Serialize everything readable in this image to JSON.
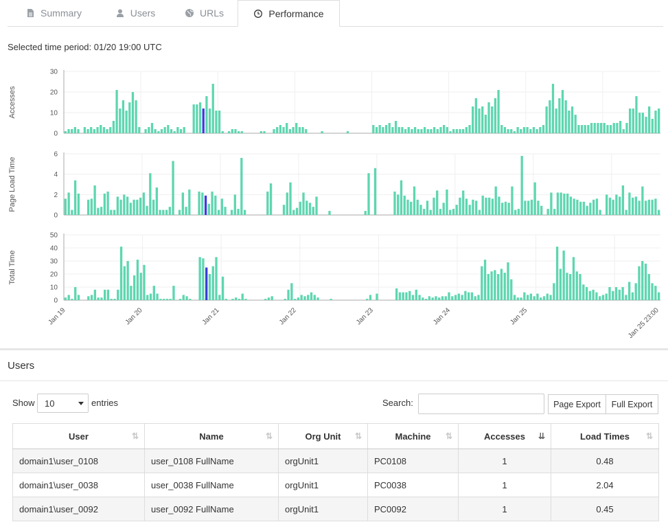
{
  "tabs": [
    {
      "label": "Summary",
      "icon": "file-icon",
      "active": false
    },
    {
      "label": "Users",
      "icon": "user-icon",
      "active": false
    },
    {
      "label": "URLs",
      "icon": "globe-icon",
      "active": false
    },
    {
      "label": "Performance",
      "icon": "clock-icon",
      "active": true
    }
  ],
  "selected_period": "Selected time period: 01/20 19:00 UTC",
  "colors": {
    "bar": "#5ed6b0",
    "highlight": "#3a3ae0",
    "grid": "#efefef",
    "axis": "#555555"
  },
  "chart_data": [
    {
      "type": "bar",
      "ylabel": "Accesses",
      "ylim": [
        0,
        30
      ],
      "yticks": [
        0,
        10,
        20,
        30
      ],
      "x_start": "Jan 19 00:00",
      "x_interval": "1 hour",
      "highlight_index": 43,
      "values": [
        1,
        2,
        2,
        3,
        2,
        0,
        3,
        2,
        3,
        2,
        3,
        4,
        3,
        2,
        3,
        6,
        21,
        12,
        16,
        11,
        15,
        20,
        16,
        3,
        0,
        2,
        3,
        5,
        2,
        1,
        2,
        3,
        4,
        2,
        1,
        3,
        2,
        3,
        0,
        0,
        14,
        14,
        15,
        12,
        18,
        12,
        24,
        11,
        11,
        1,
        0,
        1,
        2,
        2,
        1,
        1,
        0,
        0,
        0,
        0,
        0,
        1,
        1,
        0,
        0,
        2,
        3,
        4,
        3,
        5,
        2,
        3,
        5,
        3,
        3,
        2,
        0,
        0,
        0,
        0,
        1,
        0,
        0,
        0,
        0,
        0,
        0,
        0,
        1,
        0,
        0,
        0,
        0,
        0,
        0,
        0,
        4,
        3,
        4,
        3,
        4,
        5,
        3,
        6,
        3,
        3,
        2,
        3,
        2,
        3,
        2,
        2,
        3,
        2,
        2,
        3,
        2,
        3,
        4,
        3,
        1,
        2,
        2,
        2,
        2,
        3,
        4,
        13,
        17,
        12,
        13,
        9,
        15,
        13,
        17,
        21,
        4,
        3,
        2,
        2,
        1,
        3,
        2,
        3,
        3,
        2,
        3,
        2,
        3,
        4,
        13,
        16,
        24,
        12,
        17,
        21,
        16,
        11,
        13,
        9,
        4,
        4,
        4,
        4,
        5,
        5,
        5,
        5,
        5,
        4,
        4,
        5,
        5,
        6,
        2,
        5,
        12,
        12,
        18,
        10,
        10,
        8,
        13,
        7,
        11,
        12
      ]
    },
    {
      "type": "bar",
      "ylabel": "Page Load Time",
      "ylim": [
        0,
        6
      ],
      "yticks": [
        0,
        2,
        4,
        6
      ],
      "x_start": "Jan 19 00:00",
      "x_interval": "1 hour",
      "highlight_index": 43,
      "values": [
        1.6,
        2.2,
        0.5,
        3.4,
        2.1,
        0,
        0,
        1.5,
        1.6,
        2.9,
        0.7,
        0.8,
        2.1,
        2.3,
        0.5,
        0.5,
        1.8,
        1.5,
        2,
        1.8,
        1.2,
        1.5,
        1.5,
        1.7,
        2.2,
        0.9,
        4.1,
        1.5,
        2.7,
        0.5,
        0.5,
        0.5,
        0.8,
        5.3,
        0,
        0.5,
        2.2,
        0.8,
        2.5,
        0,
        0,
        2.3,
        2.2,
        1.9,
        1.1,
        2.3,
        1.9,
        0.5,
        1.6,
        0.8,
        0,
        0.5,
        2,
        0.6,
        5.6,
        0.5,
        0,
        0,
        0,
        0,
        0,
        0,
        2.3,
        3.1,
        0,
        0,
        0,
        1,
        2.2,
        3.2,
        0.5,
        0.7,
        1.3,
        2.2,
        1.4,
        1.2,
        0.8,
        1.8,
        0,
        0,
        0,
        0.4,
        0,
        0,
        0,
        0,
        0,
        0,
        0,
        0,
        0,
        0,
        0.4,
        4.1,
        0,
        4.6,
        0,
        0,
        0,
        0,
        0,
        2.3,
        2,
        3.4,
        1.9,
        1.5,
        1.3,
        2.8,
        1.5,
        1,
        0.6,
        1.4,
        0.5,
        1.7,
        2.4,
        0.6,
        1.2,
        2.5,
        0.5,
        0.6,
        1,
        1.7,
        2.4,
        1.6,
        1,
        1.5,
        1.4,
        0.5,
        1.9,
        1.7,
        1.7,
        1.6,
        2.8,
        1.8,
        1.2,
        1.3,
        1.2,
        2.8,
        0.5,
        0.6,
        5.8,
        1.4,
        1.4,
        1.5,
        3.2,
        1.4,
        0.9,
        0,
        0.6,
        2.2,
        0.6,
        2.2,
        2.2,
        2.1,
        2.1,
        1.8,
        1.6,
        1.5,
        1.3,
        1.3,
        0.9,
        1.2,
        1.5,
        1.6,
        0.5,
        0,
        2.0,
        1.7,
        1.5,
        2.0,
        1.8,
        2.9,
        0.5,
        2.2,
        1.7,
        1.8,
        1.4,
        2.8,
        1.4,
        1.5,
        1.5,
        1.6,
        0.5
      ]
    },
    {
      "type": "bar",
      "ylabel": "Total Time",
      "ylim": [
        0,
        50
      ],
      "yticks": [
        0,
        10,
        20,
        30,
        40,
        50
      ],
      "x_start": "Jan 19 00:00",
      "x_interval": "1 hour",
      "highlight_index": 43,
      "values": [
        2,
        4,
        1,
        10,
        4,
        0,
        0,
        3,
        4,
        8,
        2,
        2,
        8,
        8,
        1,
        1,
        8,
        41,
        26,
        30,
        11,
        19,
        31,
        21,
        27,
        4,
        5,
        11,
        5,
        1,
        1,
        1,
        1,
        11,
        0,
        1,
        4,
        3,
        1,
        0,
        0,
        33,
        32,
        25,
        20,
        26,
        33,
        4,
        18,
        1,
        0,
        1,
        2,
        1,
        5,
        1,
        0,
        0,
        0,
        0,
        0,
        1,
        2,
        3,
        0,
        0,
        0,
        1,
        8,
        13,
        1,
        2,
        4,
        3,
        4,
        6,
        4,
        2,
        0,
        0,
        0,
        1,
        0,
        0,
        0,
        0,
        0,
        0,
        0,
        0,
        0,
        0,
        1,
        4,
        0,
        5,
        0,
        0,
        0,
        0,
        0,
        9,
        6,
        6,
        6,
        7,
        4,
        8,
        4,
        2,
        1,
        3,
        2,
        3,
        2,
        3,
        3,
        6,
        3,
        4,
        5,
        4,
        7,
        6,
        6,
        3,
        4,
        26,
        31,
        20,
        22,
        23,
        20,
        24,
        21,
        29,
        16,
        4,
        2,
        2,
        6,
        4,
        5,
        3,
        5,
        2,
        3,
        5,
        4,
        13,
        41,
        24,
        38,
        21,
        20,
        33,
        22,
        20,
        12,
        10,
        7,
        8,
        6,
        3,
        4,
        5,
        10,
        7,
        10,
        8,
        10,
        4,
        14,
        6,
        13,
        26,
        30,
        28,
        20,
        13,
        11,
        6
      ]
    }
  ],
  "x_axis_labels": [
    "Jan 19",
    "Jan 20",
    "Jan 21",
    "Jan 22",
    "Jan 23",
    "Jan 24",
    "Jan 25",
    "Jan 25 23:00"
  ],
  "users_section": {
    "title": "Users",
    "show_label": "Show",
    "page_size": "10",
    "entries_label": "entries",
    "search_label": "Search:",
    "search_value": "",
    "page_export": "Page Export",
    "full_export": "Full Export",
    "columns": [
      "User",
      "Name",
      "Org Unit",
      "Machine",
      "Accesses",
      "Load Times"
    ],
    "rows": [
      [
        "domain1\\user_0108",
        "user_0108 FullName",
        "orgUnit1",
        "PC0108",
        "1",
        "0.48"
      ],
      [
        "domain1\\user_0038",
        "user_0038 FullName",
        "orgUnit1",
        "PC0038",
        "1",
        "2.04"
      ],
      [
        "domain1\\user_0092",
        "user_0092 FullName",
        "orgUnit1",
        "PC0092",
        "1",
        "0.45"
      ]
    ]
  }
}
